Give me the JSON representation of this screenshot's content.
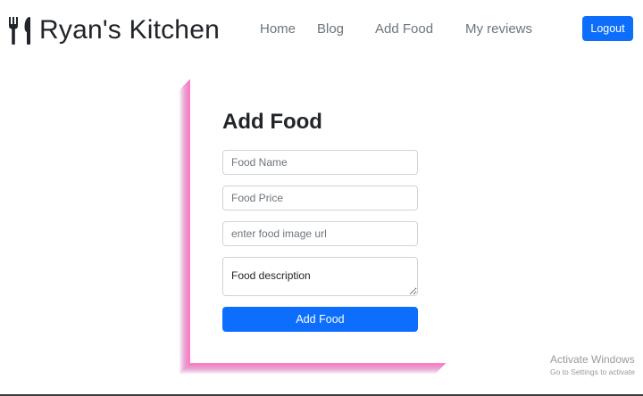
{
  "navbar": {
    "brand_icon": "fork-knife-icon",
    "brand_title": "Ryan's Kitchen",
    "links": [
      {
        "label": "Home"
      },
      {
        "label": "Blog"
      },
      {
        "label": "Add Food"
      },
      {
        "label": "My reviews"
      }
    ],
    "logout_label": "Logout"
  },
  "form": {
    "title": "Add Food",
    "name_placeholder": "Food Name",
    "price_placeholder": "Food Price",
    "image_placeholder": "enter food image url",
    "description_placeholder": "Food description",
    "submit_label": "Add Food"
  },
  "watermark": {
    "title": "Activate Windows",
    "subtitle": "Go to Settings to activate"
  },
  "colors": {
    "primary": "#0d6efd",
    "shadow_pink": "#f06cc3",
    "nav_text": "#6c757d",
    "heading": "#212529"
  }
}
